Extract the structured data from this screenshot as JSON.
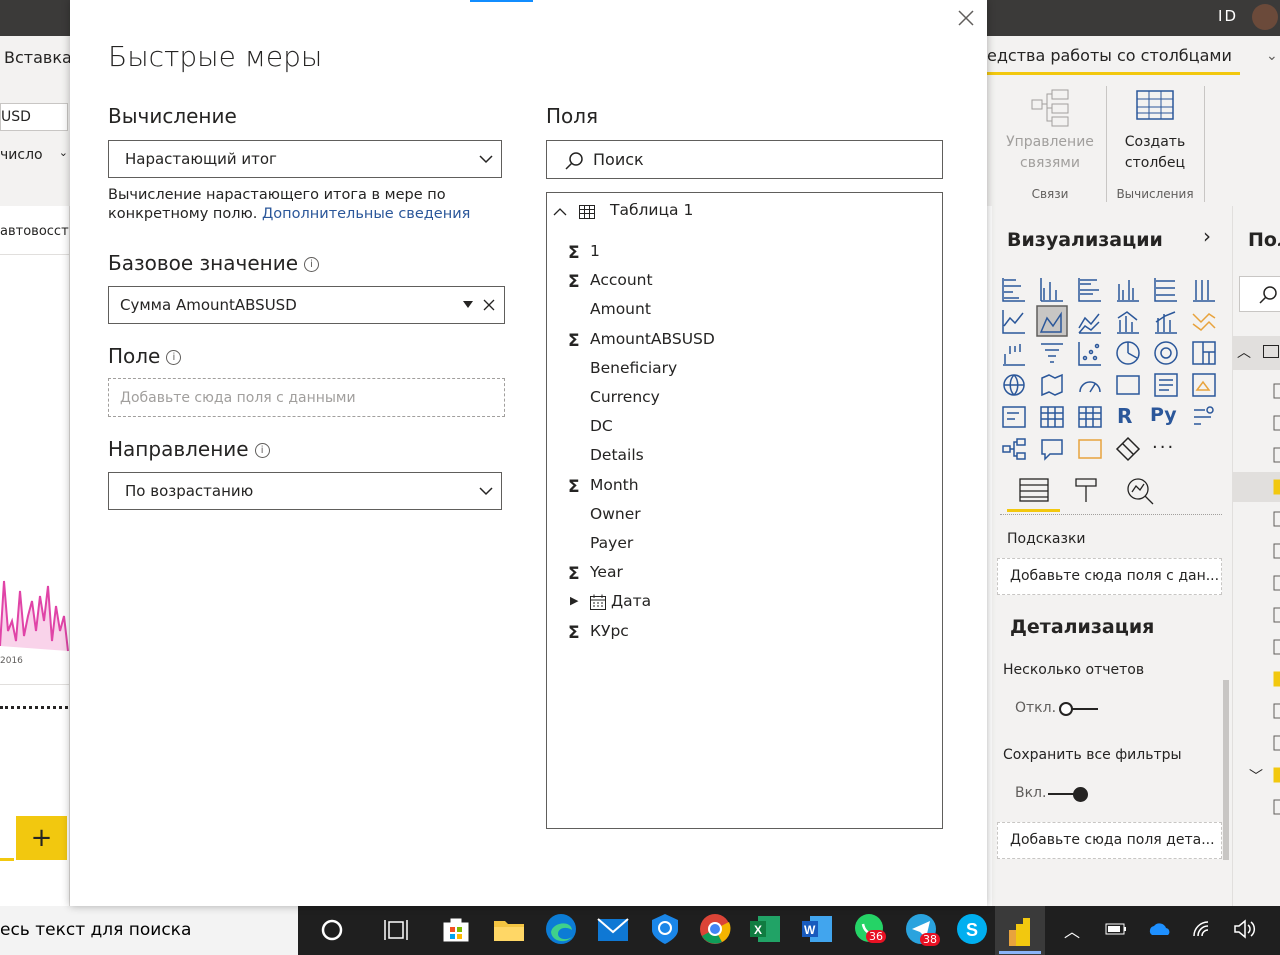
{
  "background_app": {
    "id_initials": "ID",
    "ribbon_tab_insert": "Вставка",
    "combo_currency": "USD",
    "combo_format": "число",
    "canvas_header": "автовосст",
    "chart_year_label": "2016",
    "add_page_label": "+",
    "ribbon_context_tab": "едства работы со столбцами",
    "ribbon": {
      "manage_relationships": "Управление связями",
      "relationships_group": "Связи",
      "new_column": "Создать столбец",
      "calculations_group": "Вычисления"
    },
    "visualizations": {
      "title": "Визуализации",
      "tooltips_label": "Подсказки",
      "tooltips_drop": "Добавьте сюда поля с дан...",
      "drillthrough_title": "Детализация",
      "cross_report_label": "Несколько отчетов",
      "cross_report_state": "Откл.",
      "keep_filters_label": "Сохранить все фильтры",
      "keep_filters_state": "Вкл.",
      "drillthrough_drop": "Добавьте сюда поля дета...",
      "r_icon": "R",
      "py_icon": "Py",
      "more_icon": "..."
    },
    "fields_pane_title": "Пол"
  },
  "dialog": {
    "title": "Быстрые меры",
    "calculation_label": "Вычисление",
    "calculation_value": "Нарастающий итог",
    "calculation_desc": "Вычисление нарастающего итога в мере по конкретному полю.",
    "calculation_link": "Дополнительные сведения",
    "base_value_label": "Базовое значение",
    "base_value_value": "Сумма AmountABSUSD",
    "field_label": "Поле",
    "field_placeholder": "Добавьте сюда поля с данными",
    "direction_label": "Направление",
    "direction_value": "По возрастанию",
    "fields_label": "Поля",
    "search_placeholder": "Поиск",
    "tree": {
      "table_name": "Таблица 1",
      "items": [
        {
          "name": "1",
          "sigma": true
        },
        {
          "name": "Account",
          "sigma": true
        },
        {
          "name": "Amount",
          "sigma": false
        },
        {
          "name": "AmountABSUSD",
          "sigma": true
        },
        {
          "name": "Beneficiary",
          "sigma": false
        },
        {
          "name": "Currency",
          "sigma": false
        },
        {
          "name": "DC",
          "sigma": false
        },
        {
          "name": "Details",
          "sigma": false
        },
        {
          "name": "Month",
          "sigma": true
        },
        {
          "name": "Owner",
          "sigma": false
        },
        {
          "name": "Payer",
          "sigma": false
        },
        {
          "name": "Year",
          "sigma": true
        },
        {
          "name": "Дата",
          "sigma": false,
          "hierarchy": true
        },
        {
          "name": "КУрс",
          "sigma": true
        }
      ]
    }
  },
  "taskbar": {
    "search_text": "есь текст для поиска",
    "whatsapp_badge": "36",
    "telegram_badge": "38"
  },
  "colors": {
    "accent_yellow": "#f2c80f",
    "accent_blue": "#118dff",
    "taskbar": "#1f1f1f"
  }
}
